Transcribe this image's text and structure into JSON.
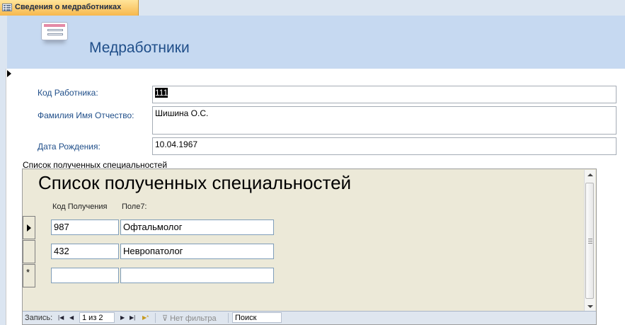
{
  "tab": {
    "title": "Сведения о медработниках",
    "icon": "form-icon"
  },
  "header": {
    "title": "Медработники",
    "icon": "form-icon"
  },
  "fields": {
    "code": {
      "label": "Код Работника:",
      "value": "111"
    },
    "name": {
      "label": "Фамилия Имя Отчество:",
      "value": "Шишина О.С."
    },
    "birth": {
      "label": "Дата Рождения:",
      "value": "10.04.1967"
    }
  },
  "subform": {
    "caption": "Список полученных специальностей",
    "title": "Список полученных специальностей",
    "columns": [
      "Код Получения",
      "Поле7:"
    ],
    "rows": [
      {
        "code": "987",
        "name": "Офтальмолог"
      },
      {
        "code": "432",
        "name": "Невропатолог"
      },
      {
        "code": "",
        "name": ""
      }
    ],
    "new_row_marker": "*"
  },
  "navigation": {
    "record_label": "Запись:",
    "position": "1 из 2",
    "filter": "Нет фильтра",
    "search": "Поиск"
  }
}
